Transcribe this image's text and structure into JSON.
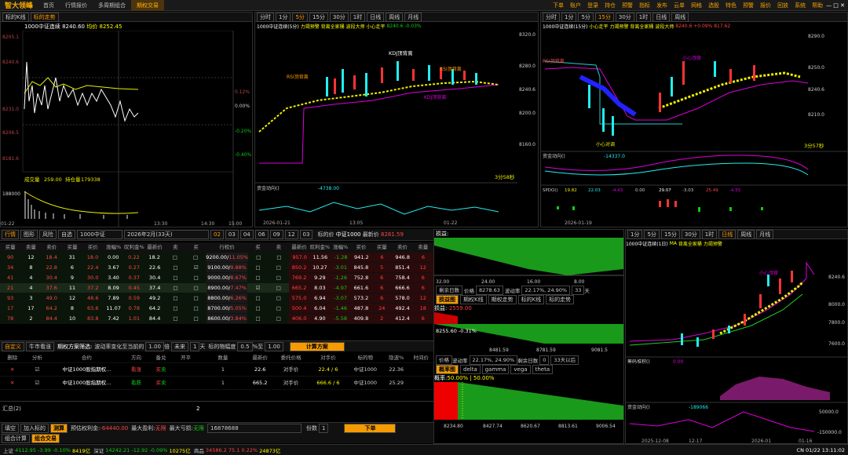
{
  "app": {
    "logo": "智大领峰",
    "tabs": [
      "首页",
      "行情报价",
      "多周期组合",
      "期权交易"
    ],
    "menus": [
      "下单",
      "账户",
      "登录",
      "持仓",
      "预警",
      "指标",
      "发布",
      "云单",
      "网格",
      "选股",
      "特色",
      "预警",
      "报价",
      "回放",
      "系统",
      "帮助"
    ]
  },
  "left_chart": {
    "tabs": [
      "标的K线",
      "标的走势"
    ],
    "title": "1000中证连续",
    "price_label": "8240.60",
    "avg_label": "均价",
    "avg": "8252.45",
    "yticks": [
      "8205.1",
      "8240.6",
      "8231.0",
      "8206.5",
      "8181.6"
    ],
    "pct": [
      "0.12%",
      "0.00%",
      "-0.20%",
      "-0.40%"
    ],
    "volume_label": "成交量",
    "volume": "259.00",
    "oi_label": "持仓量",
    "oi": "179338",
    "vol_tick": "188000",
    "times": [
      "13:30",
      "14:30",
      "15:00"
    ],
    "date": "01-22"
  },
  "k5": {
    "periods": [
      "分时",
      "1分",
      "5分",
      "15分",
      "30分",
      "1时",
      "日线",
      "周线",
      "月线"
    ],
    "title": "1000中证连续(5分)",
    "indicators": [
      "力竭预警",
      "背离全家桶",
      "波段大师",
      "小心走平"
    ],
    "price": "8240.6",
    "chg": "-0.03%",
    "labels": [
      "KDJ顶背离",
      "RSI顶背离",
      "RSI顶背离",
      "KDJ顶背离"
    ],
    "timer": "3分58秒",
    "fund": "资金动向()",
    "kline1": "-4738.00",
    "yticks": [
      "8320.0",
      "8280.0",
      "8240.6",
      "8200.0",
      "8160.0"
    ],
    "dates": [
      "2026-01-21",
      "13:05",
      "01-22"
    ]
  },
  "k15": {
    "title": "1000中证连续(15分)",
    "price": "8240.6",
    "chg": "+0.09%",
    "kline1": "817.62",
    "timer": "3分57秒",
    "fund_kline1": "-14337.0",
    "yticks": [
      "8290.0",
      "8250.0",
      "8240.6",
      "8210.0"
    ],
    "spdo": "SPDO()",
    "dif": "19.82",
    "dea": "22.03",
    "macd": "-4.43",
    "line0": "0.00",
    "line1": "29.07",
    "line2": "-3.03",
    "line3": "25.49",
    "line4": "-4.55",
    "date": "2026-01-19",
    "labels": [
      "RSI顶背离",
      "小心顶背",
      "小心对调"
    ]
  },
  "options": {
    "tabs": [
      "行情",
      "图形",
      "风险",
      "自选"
    ],
    "underlying": "1000中证",
    "month": "2026年2月(33天)",
    "strikes_tabs": [
      "02",
      "03",
      "04",
      "06",
      "09",
      "12",
      "03"
    ],
    "target_label": "标的价",
    "target": "中证1000",
    "latest_label": "最新价",
    "latest": "8281.59",
    "call_rows": [
      [
        "90",
        "12",
        "18.4",
        "31",
        "18.0",
        "0.00",
        "0.22",
        "18.2"
      ],
      [
        "34",
        "8",
        "22.8",
        "6",
        "22.4",
        "3.67",
        "0.27",
        "22.6"
      ],
      [
        "41",
        "4",
        "30.4",
        "9",
        "30.0",
        "3.40",
        "0.37",
        "30.4"
      ],
      [
        "21",
        "4",
        "37.6",
        "11",
        "37.2",
        "8.09",
        "0.45",
        "37.4"
      ],
      [
        "93",
        "3",
        "49.0",
        "12",
        "48.6",
        "7.89",
        "0.59",
        "49.2"
      ],
      [
        "17",
        "17",
        "64.2",
        "8",
        "63.6",
        "11.07",
        "0.78",
        "64.2"
      ],
      [
        "78",
        "2",
        "84.4",
        "10",
        "83.8",
        "7.42",
        "1.01",
        "84.4"
      ]
    ],
    "strikes": [
      "9200.00",
      "9100.00",
      "9000.00",
      "8900.00",
      "8800.00",
      "8700.00",
      "8600.00"
    ],
    "strike_pct": [
      "11.05%",
      "9.88%",
      "8.67%",
      "7.47%",
      "6.26%",
      "5.05%",
      "3.84%"
    ],
    "put_rows": [
      [
        "957.0",
        "11.56",
        "-1.28",
        "941.2",
        "6",
        "946.8",
        "6"
      ],
      [
        "850.2",
        "10.27",
        "-3.01",
        "845.8",
        "5",
        "851.4",
        "12"
      ],
      [
        "769.2",
        "9.29",
        "-1.26",
        "752.8",
        "6",
        "758.4",
        "6"
      ],
      [
        "665.2",
        "8.03",
        "-4.97",
        "661.6",
        "6",
        "666.6",
        "6"
      ],
      [
        "575.0",
        "6.94",
        "-3.07",
        "573.2",
        "6",
        "578.0",
        "12"
      ],
      [
        "500.4",
        "6.04",
        "-1.46",
        "487.8",
        "24",
        "492.4",
        "18"
      ],
      [
        "406.0",
        "4.90",
        "-5.58",
        "409.8",
        "2",
        "412.4",
        "6"
      ]
    ],
    "headers": [
      "买量",
      "卖量",
      "卖价",
      "买量",
      "买价",
      "涨幅%",
      "叹利金%",
      "最新价",
      "卖",
      "买",
      "行权价",
      "买",
      "卖",
      "最新价",
      "叹利金%",
      "涨幅%",
      "买价",
      "买量",
      "卖价",
      "卖量"
    ]
  },
  "strategy": {
    "custom": "自定义",
    "bull": "牛市看涨",
    "filter_label": "期权方案筛选:",
    "vol_label": "波动率变化至当前的",
    "vol": "1.00",
    "times": "倍",
    "future": "未来",
    "days": "1",
    "days_unit": "天",
    "move_label": "标的物幅度",
    "move": "0.5",
    "pct_unit": "%至",
    "to": "1.00",
    "calc": "计算方案",
    "cols": [
      "删除",
      "分析",
      "合约",
      "方向",
      "备兑",
      "开平",
      "数量",
      "最新价",
      "委托价格",
      "对手价",
      "标的物",
      "隐波%",
      "时间价"
    ],
    "legs": [
      {
        "name": "中证1000股指期权...",
        "dir": "看涨",
        "qty": "1",
        "price": "22.6",
        "order": "对手价",
        "opp": "22.4 / 6",
        "und": "中证1000",
        "iv": "22.36"
      },
      {
        "name": "中证1000股指期权...",
        "dir": "看跌",
        "qty": "1",
        "price": "665.2",
        "order": "对手价",
        "opp": "666.6 / 6",
        "und": "中证1000",
        "iv": "25.29"
      }
    ],
    "total_label": "汇总(2)",
    "total": "2",
    "tabs": [
      "填空",
      "加入标的",
      "测算"
    ],
    "pnl_label": "预估权利金:",
    "pnl": "-64440.00",
    "max_profit_label": "最大盈利:",
    "max_profit": "无限",
    "max_loss_label": "最大亏损:",
    "max_loss": "无限",
    "amount": "16878688",
    "copies_label": "份数",
    "copies": "1",
    "order": "下单",
    "combo": [
      "组合计算",
      "组合交易"
    ]
  },
  "payoff": {
    "pnl_label": "损益:",
    "xticks": [
      "32.00",
      "24.00",
      "16.00",
      "8.00"
    ],
    "remain_label": "剩余日数",
    "price_label": "价格",
    "price": "8278.63",
    "vol_label": "波动率",
    "vol": "22.17%, 24.90%",
    "days": "33",
    "day_unit": "天",
    "tabs": [
      "损益图",
      "期权K线",
      "期权走势",
      "标的K线",
      "标的走势"
    ],
    "pnl2": "-2559.00",
    "cross": "8255.60 -0.31%",
    "xticks2": [
      "8481.59",
      "8781.59",
      "9081.5"
    ],
    "price2": "价格",
    "vol2": "22.17%, 24.90%",
    "remain2": "剩余日数",
    "zero": "0",
    "days2": "33天以后",
    "tabs2": [
      "概率图",
      "delta",
      "gamma",
      "vega",
      "theta"
    ],
    "prob": "50.00% | 50.00%",
    "prob_label": "概率:",
    "xticks3": [
      "8234.80",
      "8427.74",
      "8620.67",
      "8813.61",
      "9006.54"
    ]
  },
  "daily": {
    "title": "1000中证连续(1日)",
    "ma": "MA",
    "indicators": [
      "背离全家桶",
      "力竭预警"
    ],
    "yticks": [
      "8240.6",
      "8000.0",
      "7800.0",
      "7600.0"
    ],
    "chip": "筹码堆积()",
    "kline1": "0.00",
    "fund_kline1": "-189066",
    "fund_ticks": [
      "50000.0",
      "-150000.0"
    ],
    "dates": [
      "2025-12-08",
      "12-17",
      "2026-01",
      "01-16"
    ],
    "label": "小心顶背"
  },
  "status": {
    "sh": "上证",
    "sh_v": "4112.95",
    "sh_c": "-3.99",
    "sh_p": "-0.10%",
    "sh_a": "8419亿",
    "sz": "深证",
    "sz_v": "14242.21",
    "sz_c": "-12.92",
    "sz_p": "-0.09%",
    "sz_a": "10275亿",
    "sp": "商品",
    "sp_v": "34586.2",
    "sp_c": "75.1",
    "sp_p": "0.22%",
    "sp_a": "24873亿",
    "clock": "CN 01/22 13:11:02"
  }
}
